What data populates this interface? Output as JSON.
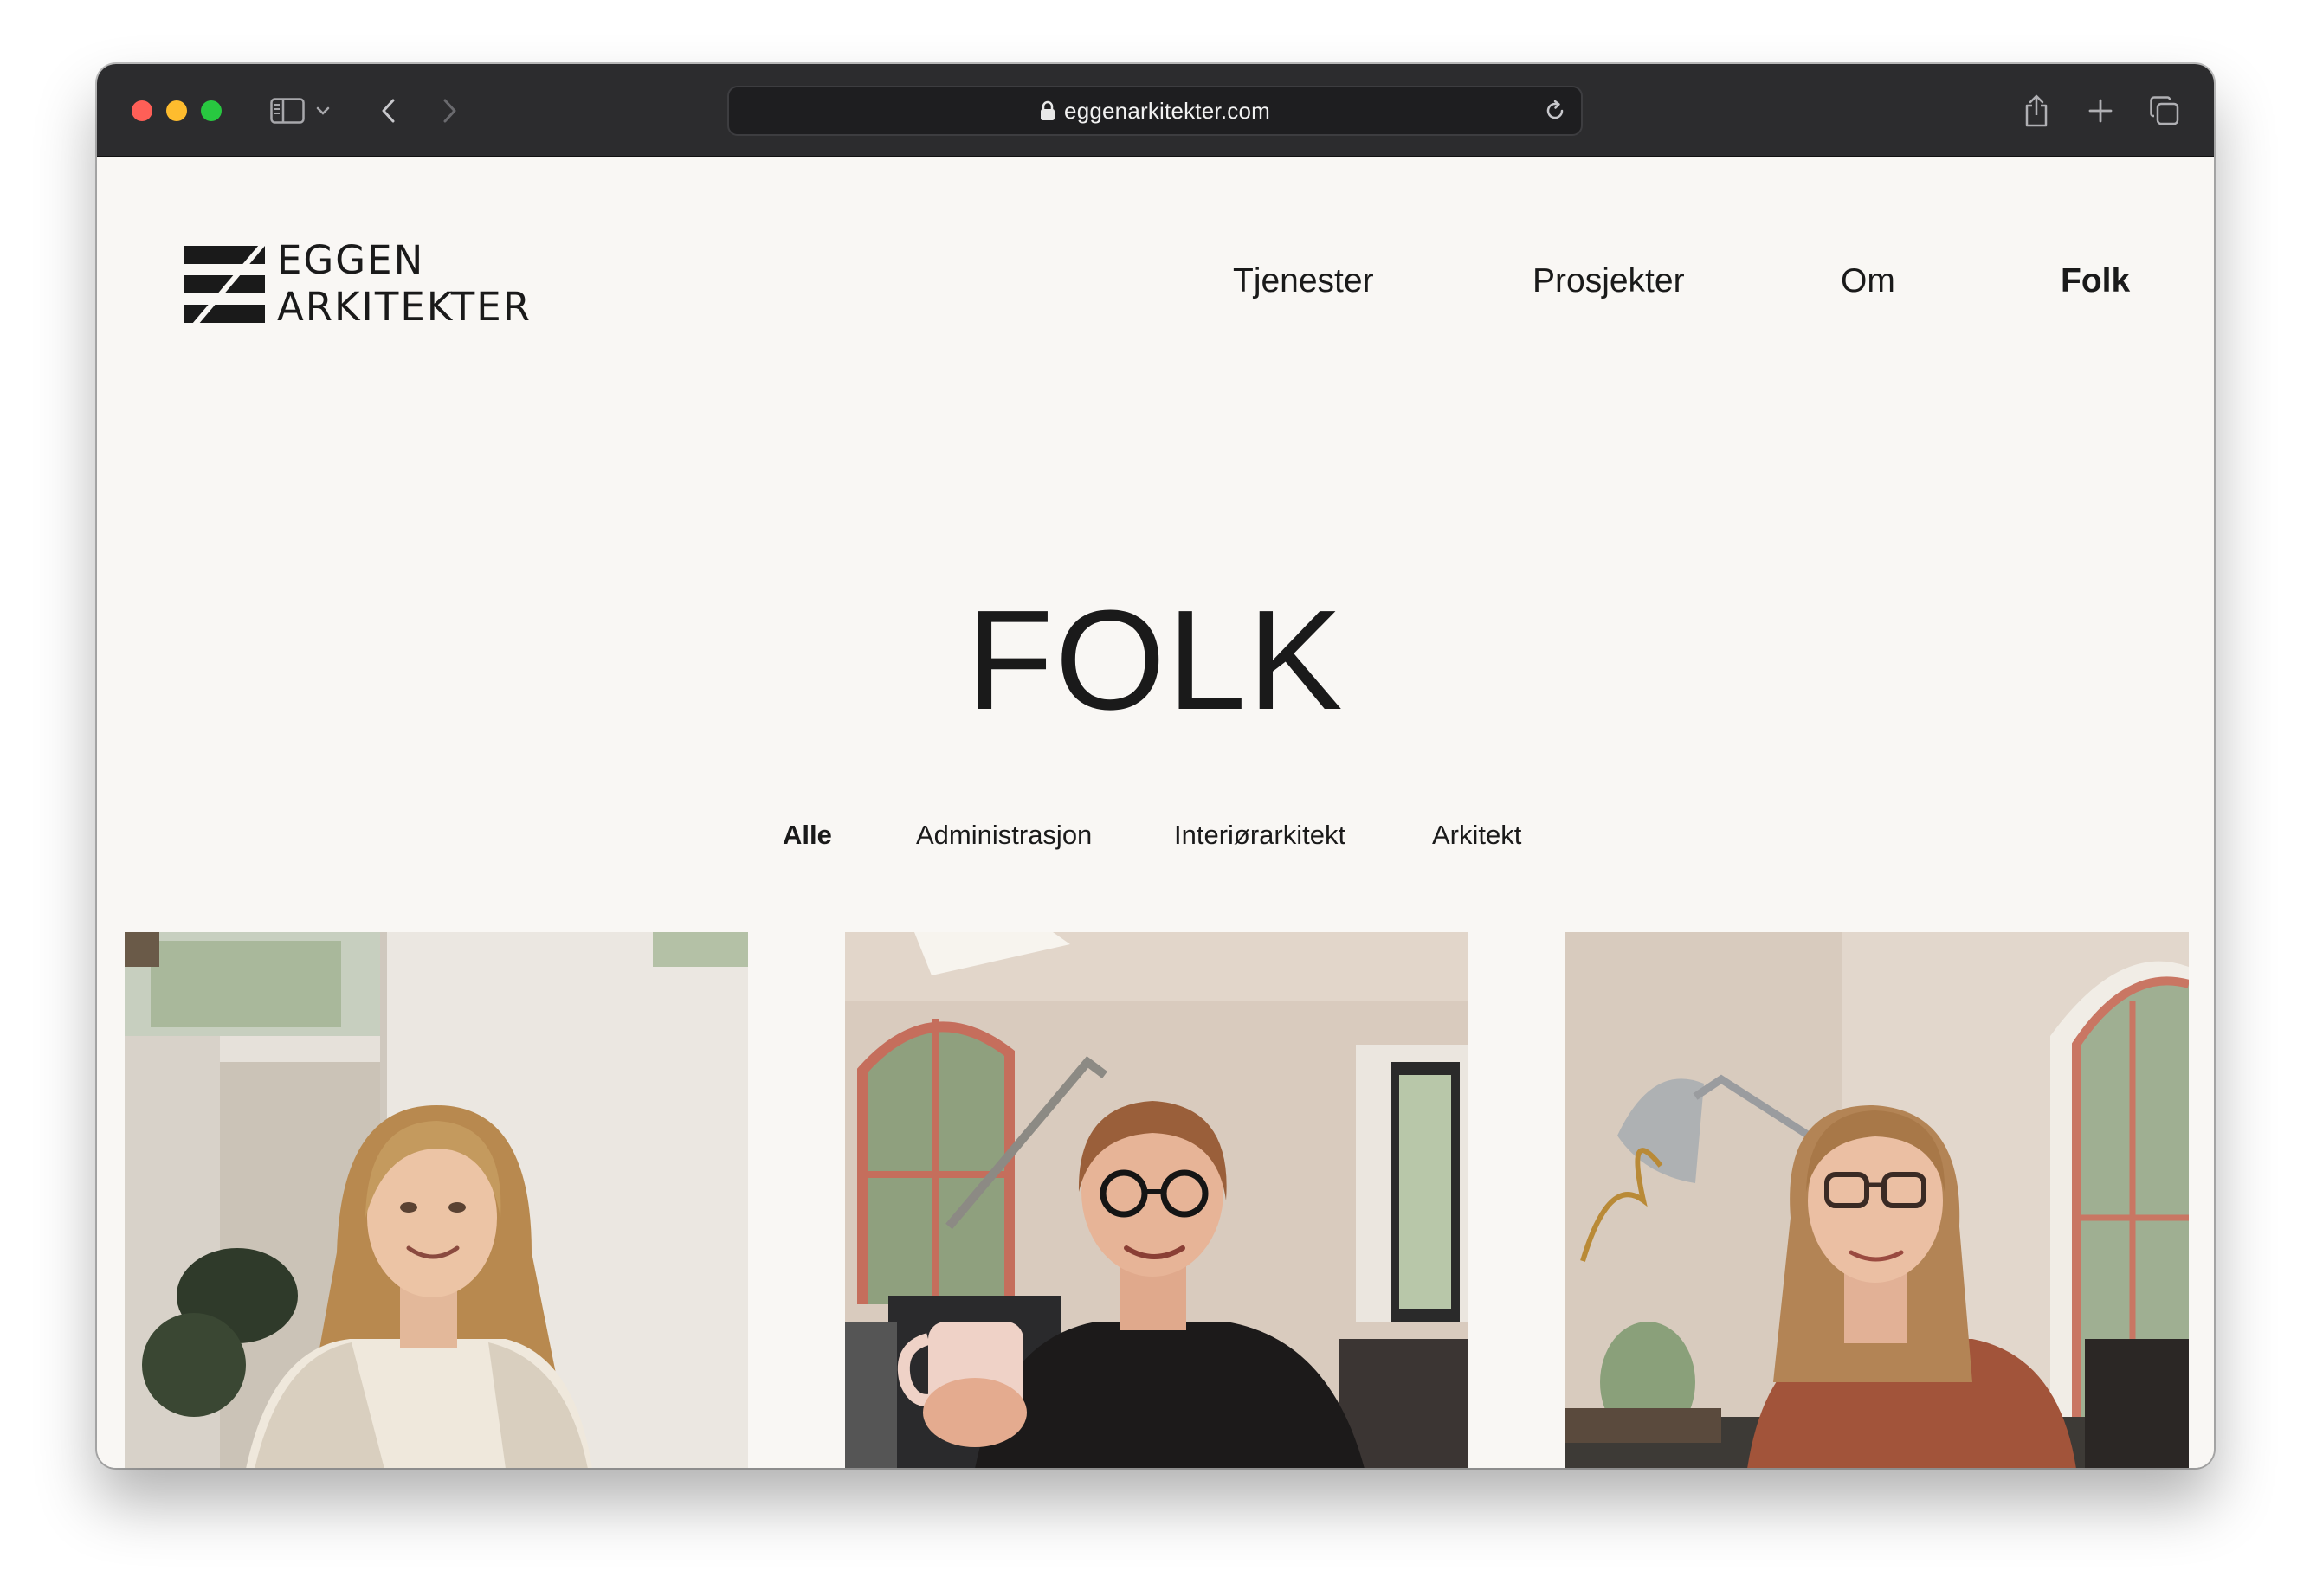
{
  "browser": {
    "url": "eggenarkitekter.com",
    "icons": {
      "sidebar": "sidebar-icon",
      "back": "chevron-left-icon",
      "forward": "chevron-right-icon",
      "lock": "lock-icon",
      "reload": "reload-icon",
      "share": "share-icon",
      "new_tab": "plus-icon",
      "tabs": "tabs-overview-icon"
    }
  },
  "site": {
    "logo_line1": "EGGEN",
    "logo_line2": "ARKITEKTER",
    "nav": [
      {
        "label": "Tjenester",
        "active": false
      },
      {
        "label": "Prosjekter",
        "active": false
      },
      {
        "label": "Om",
        "active": false
      },
      {
        "label": "Folk",
        "active": true
      }
    ]
  },
  "page": {
    "title": "FOLK",
    "filters": [
      {
        "label": "Alle",
        "active": true
      },
      {
        "label": "Administrasjon",
        "active": false
      },
      {
        "label": "Interiørarkitekt",
        "active": false
      },
      {
        "label": "Arkitekt",
        "active": false
      }
    ]
  },
  "colors": {
    "page_background": "#f9f7f4",
    "text": "#1a1a1a",
    "toolbar": "#2c2c2e"
  }
}
